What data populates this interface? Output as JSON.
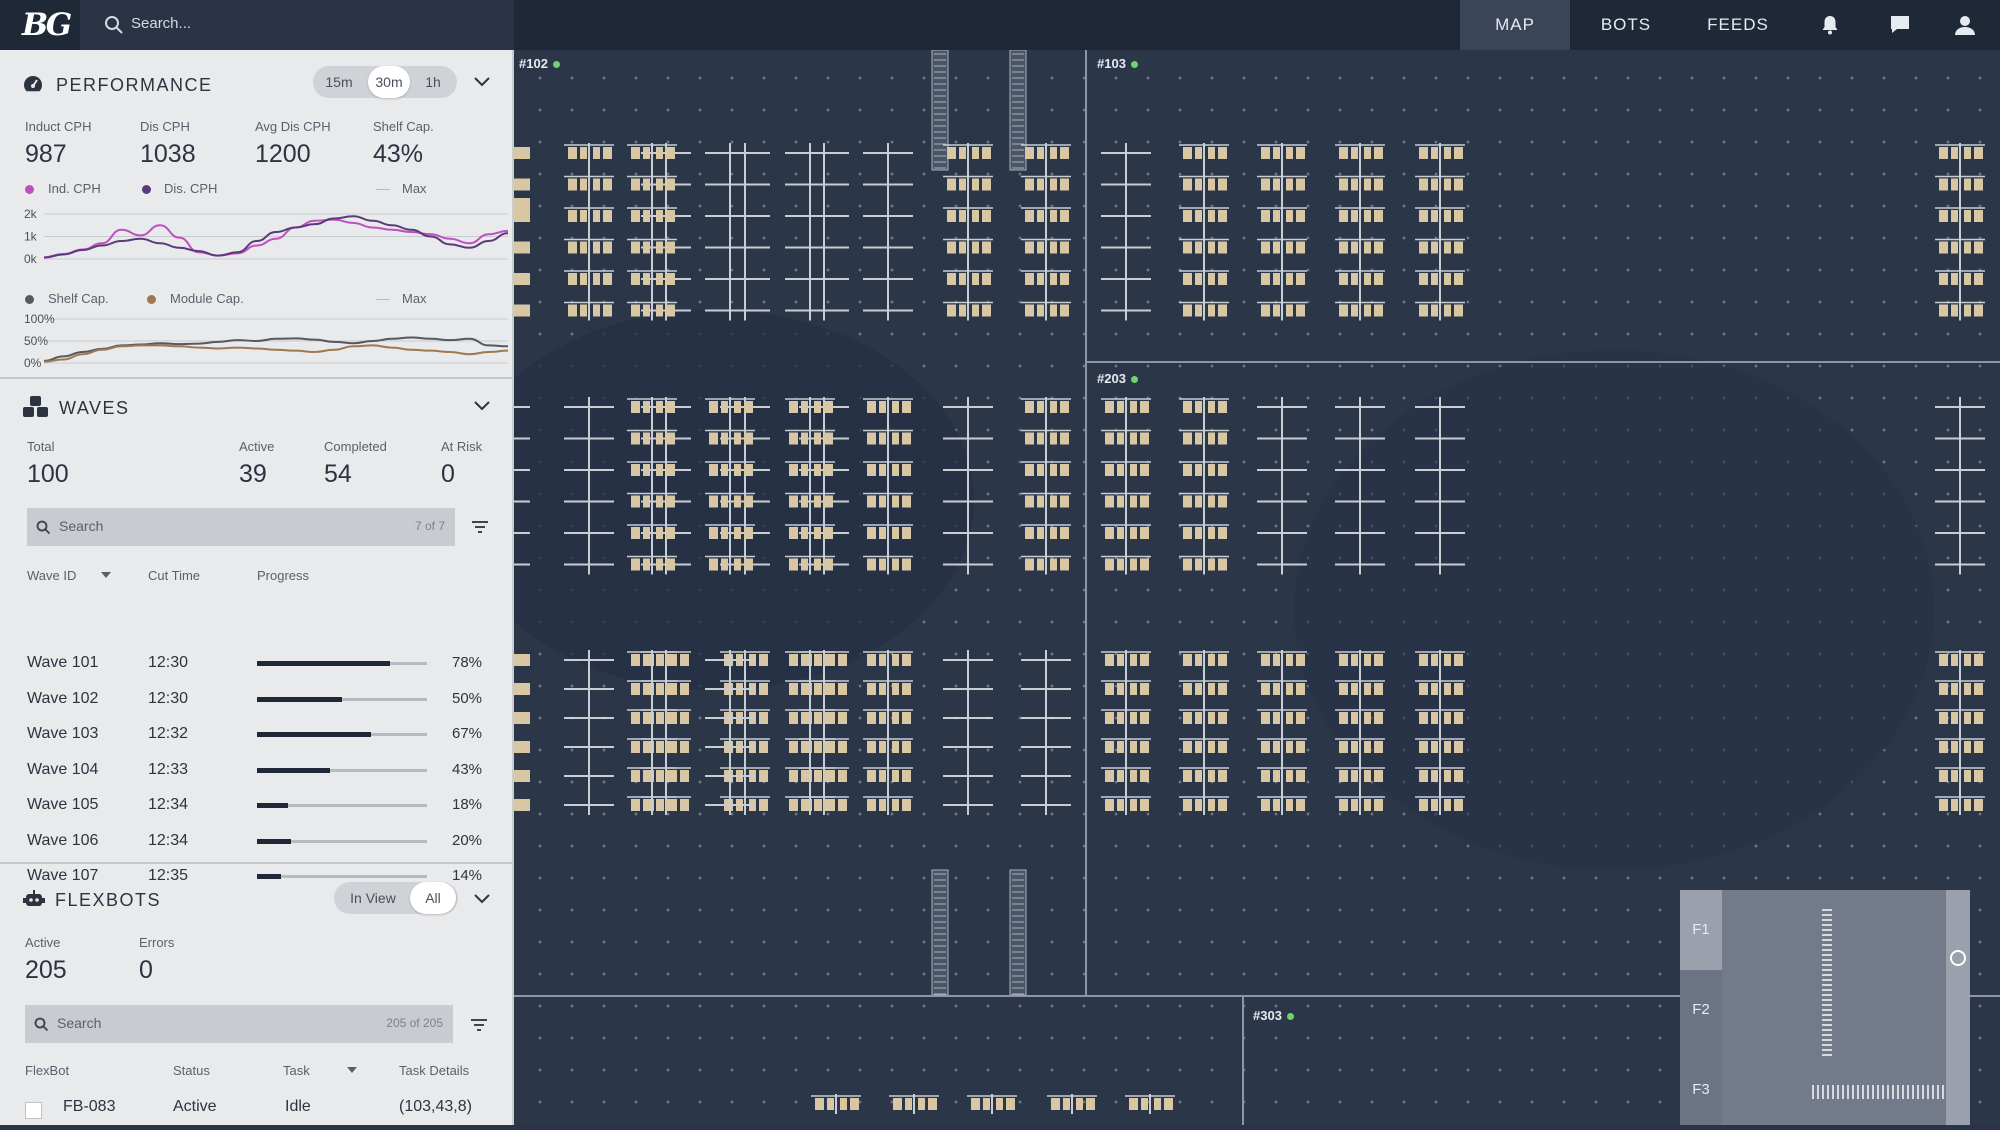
{
  "topbar": {
    "logo": "BG",
    "search_placeholder": "Search...",
    "tabs": [
      {
        "label": "MAP",
        "active": true
      },
      {
        "label": "BOTS",
        "active": false
      },
      {
        "label": "FEEDS",
        "active": false
      }
    ],
    "icons": [
      "bell-icon",
      "chat-icon",
      "user-icon"
    ]
  },
  "performance": {
    "title": "PERFORMANCE",
    "time_options": [
      "15m",
      "30m",
      "1h"
    ],
    "time_selected": "30m",
    "stats": [
      {
        "label": "Induct CPH",
        "value": "987"
      },
      {
        "label": "Dis CPH",
        "value": "1038"
      },
      {
        "label": "Avg Dis CPH",
        "value": "1200"
      },
      {
        "label": "Shelf Cap.",
        "value": "43%"
      }
    ],
    "chart1_legend": [
      {
        "label": "Ind. CPH",
        "color": "#c04fc0"
      },
      {
        "label": "Dis. CPH",
        "color": "#5a3a7a"
      },
      {
        "label": "Max",
        "color": "#b5b9c0"
      }
    ],
    "chart2_legend": [
      {
        "label": "Shelf Cap.",
        "color": "#55595f"
      },
      {
        "label": "Module Cap.",
        "color": "#a07850"
      },
      {
        "label": "Max",
        "color": "#b5b9c0"
      }
    ]
  },
  "chart_data": [
    {
      "type": "line",
      "y_ticks": [
        "2k",
        "1k",
        "0k"
      ],
      "ylim": [
        0,
        2000
      ],
      "x": [
        0,
        1,
        2,
        3,
        4,
        5,
        6,
        7,
        8,
        9,
        10,
        11,
        12,
        13,
        14,
        15,
        16,
        17,
        18,
        19,
        20,
        21,
        22,
        23,
        24
      ],
      "series": [
        {
          "name": "Ind. CPH",
          "color": "#c04fc0",
          "values": [
            80,
            220,
            420,
            700,
            1300,
            1050,
            1500,
            950,
            300,
            150,
            250,
            600,
            900,
            1400,
            1700,
            1750,
            1600,
            1400,
            1300,
            1200,
            1100,
            900,
            700,
            1100,
            1250
          ]
        },
        {
          "name": "Dis. CPH",
          "color": "#5a3a7a",
          "values": [
            60,
            200,
            400,
            600,
            800,
            900,
            700,
            500,
            350,
            150,
            300,
            800,
            1200,
            1400,
            1550,
            1800,
            1900,
            1700,
            1500,
            1300,
            1000,
            650,
            500,
            800,
            1150
          ]
        }
      ]
    },
    {
      "type": "line",
      "y_ticks": [
        "100%",
        "50%",
        "0%"
      ],
      "ylim": [
        0,
        100
      ],
      "x": [
        0,
        1,
        2,
        3,
        4,
        5,
        6,
        7,
        8,
        9,
        10,
        11,
        12,
        13,
        14,
        15,
        16,
        17,
        18,
        19,
        20,
        21,
        22,
        23,
        24
      ],
      "series": [
        {
          "name": "Shelf Cap.",
          "color": "#55595f",
          "values": [
            5,
            15,
            25,
            32,
            40,
            42,
            45,
            43,
            44,
            48,
            52,
            50,
            55,
            56,
            53,
            48,
            45,
            50,
            55,
            58,
            55,
            52,
            55,
            40,
            38
          ]
        },
        {
          "name": "Module Cap.",
          "color": "#a07850",
          "values": [
            3,
            8,
            20,
            30,
            38,
            40,
            40,
            38,
            35,
            33,
            35,
            33,
            30,
            28,
            25,
            30,
            38,
            40,
            35,
            30,
            28,
            25,
            20,
            25,
            28
          ]
        }
      ]
    }
  ],
  "waves": {
    "title": "WAVES",
    "stats": [
      {
        "label": "Total",
        "value": "100"
      },
      {
        "label": "Active",
        "value": "39"
      },
      {
        "label": "Completed",
        "value": "54"
      },
      {
        "label": "At Risk",
        "value": "0"
      }
    ],
    "search_placeholder": "Search",
    "search_count": "7 of 7",
    "columns": [
      "Wave ID",
      "Cut Time",
      "Progress"
    ],
    "rows": [
      {
        "id": "Wave 101",
        "cut": "12:30",
        "progress": 0.78,
        "pct": "78%"
      },
      {
        "id": "Wave 102",
        "cut": "12:30",
        "progress": 0.5,
        "pct": "50%"
      },
      {
        "id": "Wave 103",
        "cut": "12:32",
        "progress": 0.67,
        "pct": "67%"
      },
      {
        "id": "Wave 104",
        "cut": "12:33",
        "progress": 0.43,
        "pct": "43%"
      },
      {
        "id": "Wave 105",
        "cut": "12:34",
        "progress": 0.18,
        "pct": "18%"
      },
      {
        "id": "Wave 106",
        "cut": "12:34",
        "progress": 0.2,
        "pct": "20%"
      },
      {
        "id": "Wave 107",
        "cut": "12:35",
        "progress": 0.14,
        "pct": "14%"
      }
    ]
  },
  "flexbots": {
    "title": "FLEXBOTS",
    "view_options": [
      "In View",
      "All"
    ],
    "view_selected": "All",
    "stats": [
      {
        "label": "Active",
        "value": "205"
      },
      {
        "label": "Errors",
        "value": "0"
      }
    ],
    "search_placeholder": "Search",
    "search_count": "205 of 205",
    "columns": [
      "FlexBot",
      "Status",
      "Task",
      "Task Details"
    ],
    "rows": [
      {
        "bot": "FB-083",
        "status": "Active",
        "task": "Idle",
        "details": "(103,43,8)"
      }
    ]
  },
  "map": {
    "zones": [
      "#102",
      "#103",
      "#203",
      "#303"
    ],
    "floors": [
      "F1",
      "F2",
      "F3"
    ],
    "active_floor": "F1"
  }
}
